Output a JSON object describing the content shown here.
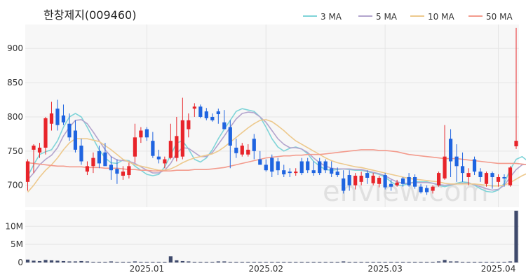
{
  "chart_data": {
    "type": "candlestick",
    "title": "한창제지(009460)",
    "watermark": "enview.com",
    "x_tick_labels": [
      "2025.01",
      "2025.02",
      "2025.03",
      "2025.04"
    ],
    "price_axis": {
      "ylim": [
        668,
        935
      ],
      "ticks": [
        700,
        750,
        800,
        850,
        900
      ]
    },
    "volume_axis": {
      "ylim": [
        0,
        14500000
      ],
      "ticks": [
        0,
        5000000,
        10000000
      ],
      "tick_labels": [
        "0",
        "5M",
        "10M"
      ]
    },
    "grid": true,
    "legend_position": "top-right",
    "colors": {
      "up": "#e8242a",
      "down": "#1f64e0",
      "volume": "#3f4a6c",
      "grid": "#e5e5e5",
      "panel": "#f7f7f7"
    },
    "ma_series": [
      {
        "name": "3 MA",
        "color": "#7fd4d8",
        "values": [
          713,
          730,
          745,
          749,
          752,
          765,
          785,
          800,
          805,
          800,
          785,
          768,
          752,
          740,
          733,
          732,
          737,
          736,
          728,
          722,
          716,
          714,
          716,
          727,
          744,
          762,
          765,
          753,
          738,
          734,
          740,
          752,
          768,
          782,
          795,
          808,
          812,
          810,
          808,
          800,
          785,
          768,
          756,
          750,
          754,
          756,
          753,
          746,
          735,
          728,
          723,
          722,
          723,
          724,
          723,
          722,
          722,
          720,
          718,
          716,
          712,
          705,
          700,
          700,
          703,
          705,
          705,
          705,
          703,
          700,
          698,
          700,
          703,
          705,
          704,
          700,
          695,
          691,
          690,
          693,
          703,
          723,
          738,
          742,
          735,
          727,
          720,
          714,
          711,
          712,
          713,
          716,
          725
        ]
      },
      {
        "name": "5 MA",
        "color": "#b3a4cd",
        "values": [
          708,
          718,
          730,
          738,
          744,
          755,
          772,
          785,
          795,
          796,
          790,
          778,
          765,
          752,
          742,
          737,
          736,
          735,
          732,
          727,
          722,
          718,
          718,
          722,
          732,
          747,
          755,
          754,
          748,
          742,
          742,
          748,
          760,
          772,
          785,
          797,
          805,
          807,
          806,
          800,
          792,
          780,
          768,
          760,
          755,
          755,
          753,
          748,
          740,
          733,
          728,
          725,
          724,
          724,
          724,
          723,
          723,
          721,
          719,
          717,
          714,
          709,
          705,
          703,
          703,
          704,
          704,
          704,
          703,
          701,
          700,
          701,
          702,
          703,
          703,
          701,
          698,
          695,
          693,
          694,
          700,
          712,
          723,
          730,
          731,
          729,
          725,
          720,
          715,
          713,
          713,
          715,
          720
        ]
      },
      {
        "name": "10 MA",
        "color": "#edc98d",
        "values": [
          690,
          700,
          712,
          722,
          730,
          740,
          752,
          762,
          768,
          768,
          768,
          766,
          764,
          758,
          752,
          745,
          738,
          734,
          730,
          728,
          726,
          724,
          722,
          722,
          724,
          728,
          733,
          737,
          740,
          742,
          744,
          746,
          750,
          756,
          763,
          770,
          777,
          784,
          790,
          795,
          796,
          793,
          787,
          780,
          772,
          765,
          760,
          755,
          750,
          745,
          740,
          736,
          733,
          731,
          729,
          727,
          726,
          724,
          722,
          720,
          718,
          716,
          714,
          712,
          710,
          709,
          708,
          707,
          706,
          705,
          703,
          702,
          702,
          702,
          702,
          702,
          701,
          700,
          699,
          699,
          700,
          704,
          709,
          714,
          718,
          721,
          722,
          722,
          721,
          720,
          719,
          718,
          717
        ]
      },
      {
        "name": "50 MA",
        "color": "#f39b8d",
        "values": [
          733,
          732,
          731,
          730,
          729,
          728,
          728,
          727,
          727,
          727,
          726,
          726,
          726,
          725,
          725,
          725,
          724,
          723,
          723,
          722,
          722,
          721,
          721,
          721,
          721,
          722,
          722,
          722,
          723,
          723,
          723,
          724,
          725,
          726,
          728,
          730,
          732,
          734,
          736,
          738,
          740,
          741,
          742,
          743,
          743,
          744,
          744,
          745,
          745,
          745,
          746,
          747,
          748,
          749,
          750,
          751,
          752,
          752,
          752,
          751,
          751,
          750,
          749,
          747,
          745,
          744,
          743,
          742,
          741,
          740,
          739,
          739,
          739,
          738,
          737,
          736,
          735,
          734,
          733,
          732,
          732,
          732,
          732,
          731,
          730,
          729,
          729,
          729,
          728,
          727,
          725,
          724,
          723
        ]
      }
    ],
    "candles": [
      {
        "o": 705,
        "h": 738,
        "l": 692,
        "c": 735
      },
      {
        "o": 752,
        "h": 760,
        "l": 718,
        "c": 758
      },
      {
        "o": 748,
        "h": 762,
        "l": 740,
        "c": 755
      },
      {
        "o": 755,
        "h": 800,
        "l": 745,
        "c": 798
      },
      {
        "o": 790,
        "h": 822,
        "l": 780,
        "c": 805
      },
      {
        "o": 812,
        "h": 825,
        "l": 780,
        "c": 788
      },
      {
        "o": 802,
        "h": 818,
        "l": 788,
        "c": 792
      },
      {
        "o": 790,
        "h": 805,
        "l": 765,
        "c": 770
      },
      {
        "o": 780,
        "h": 795,
        "l": 748,
        "c": 752
      },
      {
        "o": 758,
        "h": 768,
        "l": 730,
        "c": 735
      },
      {
        "o": 720,
        "h": 735,
        "l": 715,
        "c": 728
      },
      {
        "o": 728,
        "h": 748,
        "l": 718,
        "c": 740
      },
      {
        "o": 750,
        "h": 758,
        "l": 725,
        "c": 732
      },
      {
        "o": 748,
        "h": 762,
        "l": 735,
        "c": 728
      },
      {
        "o": 730,
        "h": 742,
        "l": 708,
        "c": 722
      },
      {
        "o": 724,
        "h": 738,
        "l": 702,
        "c": 717
      },
      {
        "o": 714,
        "h": 728,
        "l": 708,
        "c": 720
      },
      {
        "o": 715,
        "h": 733,
        "l": 710,
        "c": 728
      },
      {
        "o": 742,
        "h": 790,
        "l": 733,
        "c": 770
      },
      {
        "o": 770,
        "h": 785,
        "l": 762,
        "c": 780
      },
      {
        "o": 782,
        "h": 785,
        "l": 765,
        "c": 770
      },
      {
        "o": 765,
        "h": 778,
        "l": 740,
        "c": 743
      },
      {
        "o": 742,
        "h": 752,
        "l": 732,
        "c": 738
      },
      {
        "o": 732,
        "h": 742,
        "l": 725,
        "c": 738
      },
      {
        "o": 740,
        "h": 790,
        "l": 738,
        "c": 765
      },
      {
        "o": 740,
        "h": 800,
        "l": 735,
        "c": 772
      },
      {
        "o": 742,
        "h": 828,
        "l": 738,
        "c": 795
      },
      {
        "o": 782,
        "h": 805,
        "l": 770,
        "c": 795
      },
      {
        "o": 812,
        "h": 820,
        "l": 800,
        "c": 815
      },
      {
        "o": 815,
        "h": 818,
        "l": 798,
        "c": 800
      },
      {
        "o": 808,
        "h": 813,
        "l": 795,
        "c": 798
      },
      {
        "o": 800,
        "h": 805,
        "l": 793,
        "c": 795
      },
      {
        "o": 808,
        "h": 812,
        "l": 790,
        "c": 804
      },
      {
        "o": 792,
        "h": 810,
        "l": 785,
        "c": 782
      },
      {
        "o": 785,
        "h": 795,
        "l": 725,
        "c": 758
      },
      {
        "o": 755,
        "h": 768,
        "l": 740,
        "c": 747
      },
      {
        "o": 745,
        "h": 762,
        "l": 742,
        "c": 758
      },
      {
        "o": 745,
        "h": 760,
        "l": 742,
        "c": 752
      },
      {
        "o": 768,
        "h": 775,
        "l": 738,
        "c": 750
      },
      {
        "o": 738,
        "h": 750,
        "l": 730,
        "c": 730
      },
      {
        "o": 730,
        "h": 738,
        "l": 720,
        "c": 722
      },
      {
        "o": 740,
        "h": 745,
        "l": 712,
        "c": 720
      },
      {
        "o": 735,
        "h": 740,
        "l": 715,
        "c": 722
      },
      {
        "o": 722,
        "h": 730,
        "l": 712,
        "c": 716
      },
      {
        "o": 720,
        "h": 725,
        "l": 712,
        "c": 718
      },
      {
        "o": 718,
        "h": 725,
        "l": 714,
        "c": 720
      },
      {
        "o": 735,
        "h": 740,
        "l": 715,
        "c": 718
      },
      {
        "o": 735,
        "h": 740,
        "l": 718,
        "c": 722
      },
      {
        "o": 722,
        "h": 735,
        "l": 714,
        "c": 718
      },
      {
        "o": 735,
        "h": 740,
        "l": 715,
        "c": 718
      },
      {
        "o": 735,
        "h": 738,
        "l": 718,
        "c": 722
      },
      {
        "o": 725,
        "h": 735,
        "l": 712,
        "c": 717
      },
      {
        "o": 720,
        "h": 726,
        "l": 712,
        "c": 715
      },
      {
        "o": 710,
        "h": 722,
        "l": 688,
        "c": 692
      },
      {
        "o": 715,
        "h": 722,
        "l": 692,
        "c": 700
      },
      {
        "o": 700,
        "h": 718,
        "l": 694,
        "c": 714
      },
      {
        "o": 705,
        "h": 720,
        "l": 700,
        "c": 714
      },
      {
        "o": 718,
        "h": 722,
        "l": 702,
        "c": 711
      },
      {
        "o": 703,
        "h": 718,
        "l": 700,
        "c": 714
      },
      {
        "o": 702,
        "h": 714,
        "l": 697,
        "c": 711
      },
      {
        "o": 715,
        "h": 718,
        "l": 694,
        "c": 697
      },
      {
        "o": 702,
        "h": 708,
        "l": 692,
        "c": 698
      },
      {
        "o": 700,
        "h": 708,
        "l": 698,
        "c": 704
      },
      {
        "o": 710,
        "h": 712,
        "l": 698,
        "c": 702
      },
      {
        "o": 712,
        "h": 718,
        "l": 698,
        "c": 700
      },
      {
        "o": 712,
        "h": 716,
        "l": 695,
        "c": 698
      },
      {
        "o": 698,
        "h": 702,
        "l": 688,
        "c": 690
      },
      {
        "o": 696,
        "h": 700,
        "l": 686,
        "c": 690
      },
      {
        "o": 692,
        "h": 700,
        "l": 688,
        "c": 698
      },
      {
        "o": 700,
        "h": 720,
        "l": 698,
        "c": 718
      },
      {
        "o": 710,
        "h": 788,
        "l": 708,
        "c": 742
      },
      {
        "o": 768,
        "h": 782,
        "l": 712,
        "c": 735
      },
      {
        "o": 742,
        "h": 760,
        "l": 705,
        "c": 728
      },
      {
        "o": 728,
        "h": 748,
        "l": 705,
        "c": 718
      },
      {
        "o": 712,
        "h": 725,
        "l": 700,
        "c": 718
      },
      {
        "o": 738,
        "h": 742,
        "l": 715,
        "c": 720
      },
      {
        "o": 720,
        "h": 725,
        "l": 705,
        "c": 712
      },
      {
        "o": 702,
        "h": 720,
        "l": 698,
        "c": 718
      },
      {
        "o": 718,
        "h": 720,
        "l": 695,
        "c": 712
      },
      {
        "o": 705,
        "h": 716,
        "l": 698,
        "c": 712
      },
      {
        "o": 712,
        "h": 716,
        "l": 698,
        "c": 710
      },
      {
        "o": 700,
        "h": 728,
        "l": 698,
        "c": 726
      },
      {
        "o": 757,
        "h": 930,
        "l": 753,
        "c": 765
      }
    ],
    "volumes": [
      800000,
      500000,
      400000,
      700000,
      600000,
      500000,
      400000,
      300000,
      300000,
      400000,
      300000,
      200000,
      200000,
      200000,
      300000,
      200000,
      200000,
      200000,
      300000,
      200000,
      200000,
      200000,
      200000,
      200000,
      1700000,
      600000,
      400000,
      300000,
      200000,
      200000,
      200000,
      200000,
      300000,
      300000,
      200000,
      200000,
      200000,
      200000,
      200000,
      200000,
      200000,
      200000,
      200000,
      200000,
      200000,
      200000,
      200000,
      200000,
      200000,
      200000,
      200000,
      200000,
      200000,
      300000,
      200000,
      200000,
      200000,
      200000,
      200000,
      200000,
      200000,
      200000,
      200000,
      200000,
      200000,
      200000,
      200000,
      200000,
      200000,
      300000,
      700000,
      300000,
      300000,
      200000,
      200000,
      200000,
      200000,
      200000,
      200000,
      200000,
      200000,
      300000,
      14300000
    ]
  }
}
